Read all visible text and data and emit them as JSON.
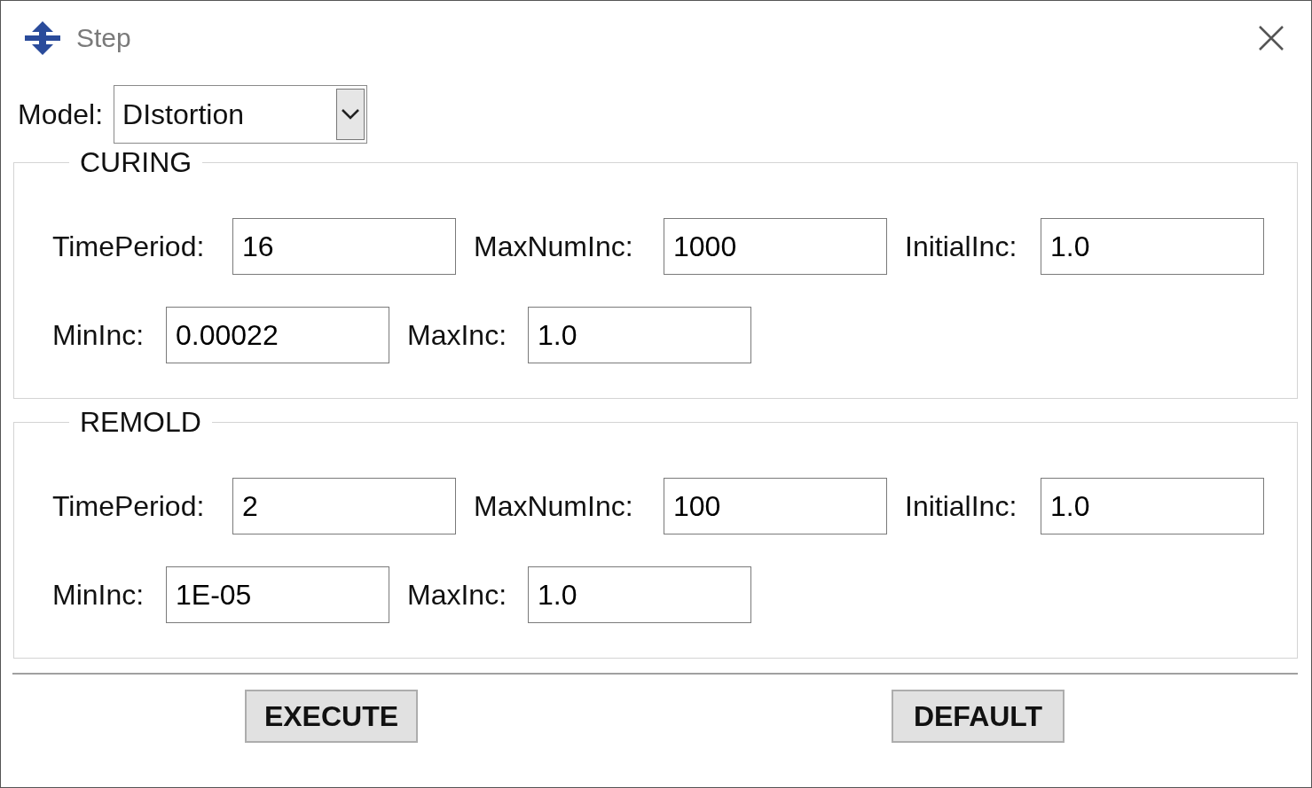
{
  "window": {
    "title": "Step"
  },
  "model": {
    "label": "Model:",
    "value": "DIstortion"
  },
  "groups": [
    {
      "title": "CURING",
      "rows": [
        {
          "fields": [
            {
              "label": "TimePeriod:",
              "value": "16"
            },
            {
              "label": "MaxNumInc:",
              "value": "1000"
            },
            {
              "label": "InitialInc:",
              "value": "1.0"
            }
          ]
        },
        {
          "fields": [
            {
              "label": "MinInc:",
              "value": "0.00022"
            },
            {
              "label": "MaxInc:",
              "value": "1.0"
            }
          ]
        }
      ]
    },
    {
      "title": "REMOLD",
      "rows": [
        {
          "fields": [
            {
              "label": "TimePeriod:",
              "value": "2"
            },
            {
              "label": "MaxNumInc:",
              "value": "100"
            },
            {
              "label": "InitialInc:",
              "value": "1.0"
            }
          ]
        },
        {
          "fields": [
            {
              "label": "MinInc:",
              "value": "1E-05"
            },
            {
              "label": "MaxInc:",
              "value": "1.0"
            }
          ]
        }
      ]
    }
  ],
  "buttons": [
    "EXECUTE",
    "DEFAULT"
  ]
}
